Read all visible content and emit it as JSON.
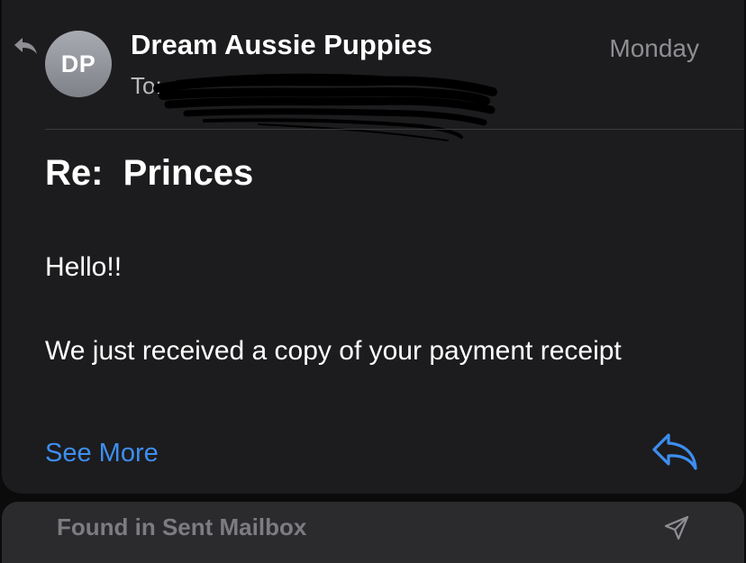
{
  "message": {
    "sender_initials": "DP",
    "sender_name": "Dream Aussie Puppies",
    "date": "Monday",
    "to_label": "To:",
    "subject": "Re:  Princes",
    "greeting": "Hello!!",
    "body": "We just received a copy of your payment receipt",
    "see_more_label": "See More"
  },
  "footer": {
    "status_text": "Found in Sent Mailbox"
  },
  "icons": {
    "top_left": "reply-arrow-icon",
    "reply_button": "reply-arrow-icon",
    "footer": "paper-plane-icon"
  },
  "colors": {
    "background": "#1c1c1e",
    "accent": "#3d8ef0",
    "secondary_text": "#8e8e93"
  }
}
